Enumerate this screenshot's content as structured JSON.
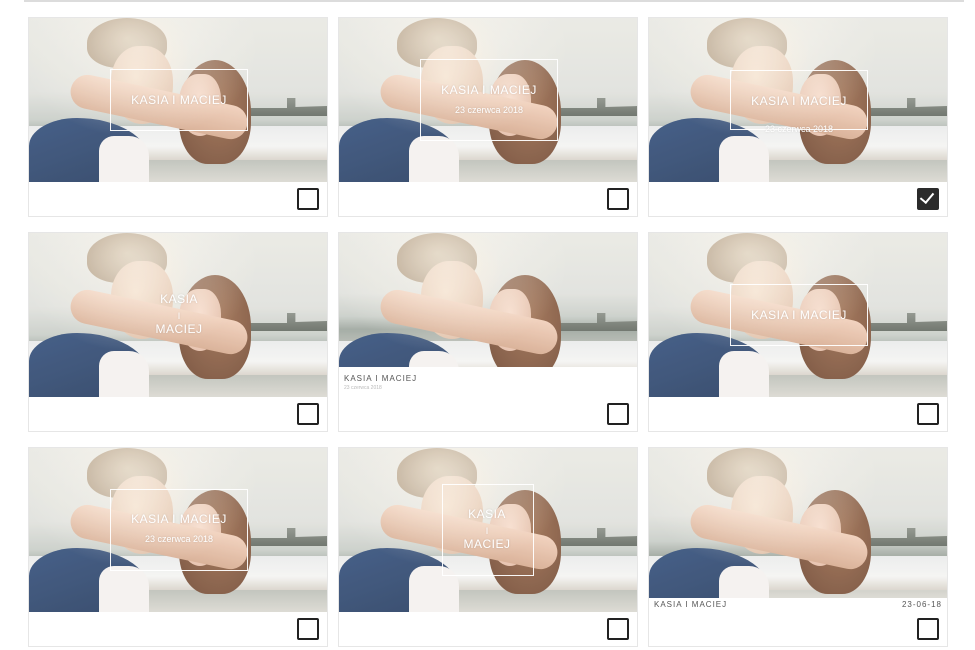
{
  "cards": [
    {
      "id": "1",
      "names": "KASIA I MACIEJ",
      "date": "",
      "selected": false
    },
    {
      "id": "2",
      "names": "KASIA I MACIEJ",
      "date": "23 czerwca 2018",
      "selected": false
    },
    {
      "id": "3",
      "names": "KASIA I MACIEJ",
      "date": "23 czerwca 2018",
      "selected": true
    },
    {
      "id": "4",
      "name_line1": "KASIA",
      "name_sep": "I",
      "name_line2": "MACIEJ",
      "selected": false
    },
    {
      "id": "5",
      "names": "KASIA I MACIEJ",
      "date": "23 czerwca 2018",
      "selected": false
    },
    {
      "id": "6",
      "names": "KASIA I MACIEJ",
      "selected": false
    },
    {
      "id": "7",
      "names": "KASIA I MACIEJ",
      "date": "23 czerwca 2018",
      "selected": false
    },
    {
      "id": "8",
      "name_line1": "KASIA",
      "name_sep": "I",
      "name_line2": "MACIEJ",
      "selected": false
    },
    {
      "id": "9",
      "names": "KASIA I MACIEJ",
      "date": "23-06-18",
      "selected": false
    }
  ]
}
